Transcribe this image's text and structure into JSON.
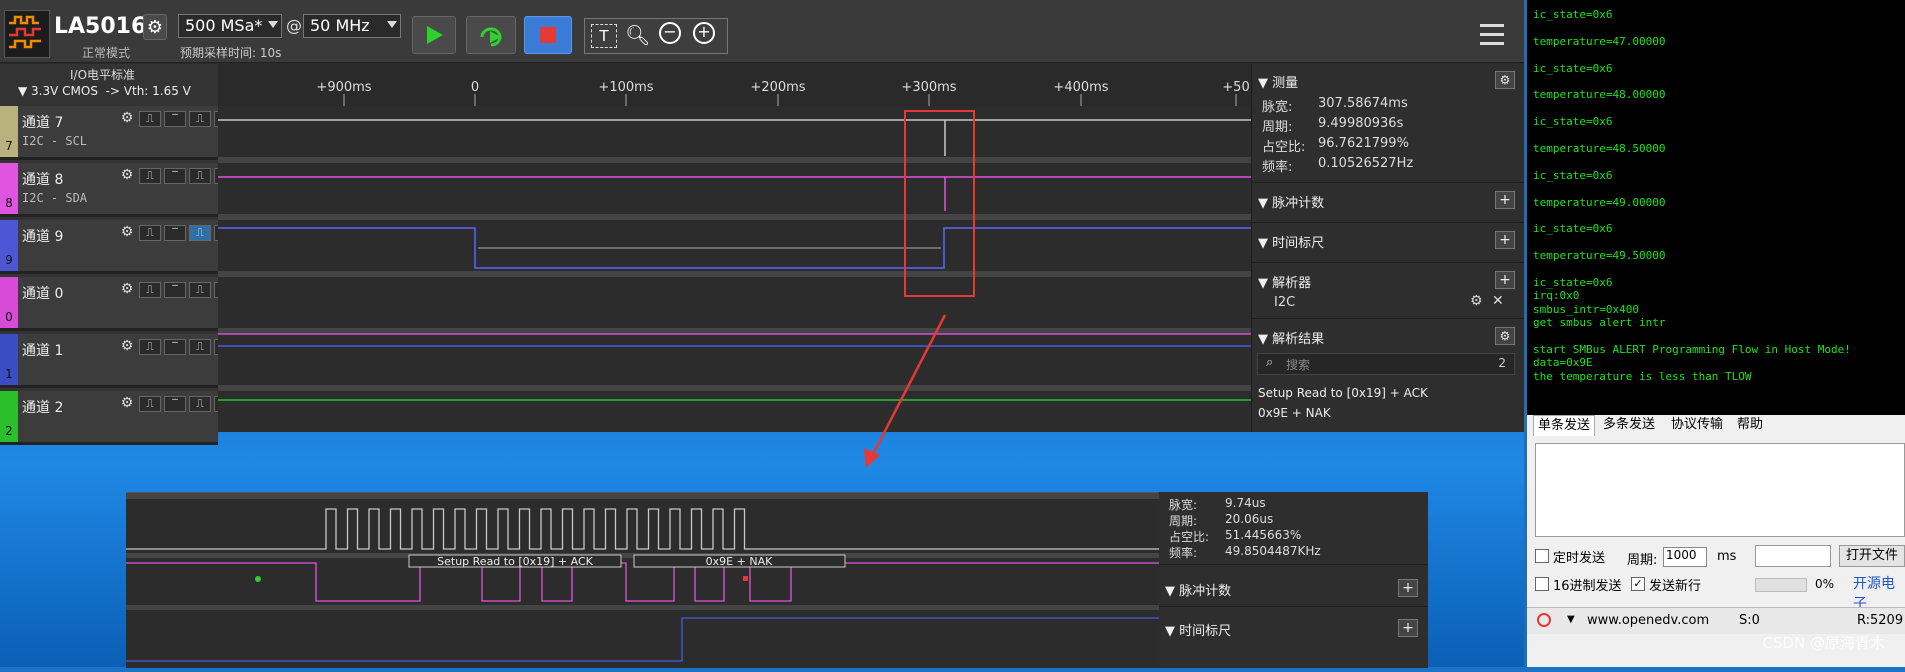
{
  "app": {
    "title": "LA5016",
    "mode": "正常模式"
  },
  "toolbar": {
    "sample_rate": "500 MSa*",
    "at": "@",
    "frequency": "50 MHz",
    "expected_time": "预期采样时间: 10s"
  },
  "io": {
    "header": "I/O电平标准",
    "level": "▼ 3.3V CMOS  -> Vth: 1.65 V"
  },
  "channels": [
    {
      "num": "7",
      "name": "通道 7",
      "sub": "I2C - SCL",
      "color": "#b9b27e"
    },
    {
      "num": "8",
      "name": "通道 8",
      "sub": "I2C - SDA",
      "color": "#e055e0"
    },
    {
      "num": "9",
      "name": "通道 9",
      "sub": "",
      "color": "#4f56d6"
    },
    {
      "num": "0",
      "name": "通道 0",
      "sub": "",
      "color": "#d84bd8"
    },
    {
      "num": "1",
      "name": "通道 1",
      "sub": "",
      "color": "#3a4dc2"
    },
    {
      "num": "2",
      "name": "通道 2",
      "sub": "",
      "color": "#2cbf2c"
    }
  ],
  "timeline": {
    "ticks": [
      "+900ms",
      "0",
      "+100ms",
      "+200ms",
      "+300ms",
      "+400ms",
      "+50"
    ]
  },
  "measure": {
    "title": "测量",
    "rows": [
      {
        "k": "脉宽:",
        "v": "307.58674ms"
      },
      {
        "k": "周期:",
        "v": "9.49980936s"
      },
      {
        "k": "占空比:",
        "v": "96.7621799%"
      },
      {
        "k": "频率:",
        "v": "0.10526527Hz"
      }
    ]
  },
  "panels": {
    "pulse_count": "脉冲计数",
    "time_ruler": "时间标尺",
    "decoder": "解析器",
    "decoder_item": "I2C",
    "results": "解析结果",
    "search_placeholder": "搜索",
    "search_count": "2",
    "result_lines": [
      "Setup Read to [0x19] + ACK",
      "0x9E + NAK"
    ]
  },
  "terminal": {
    "lines": [
      "ic_state=0x6",
      "",
      "temperature=47.00000",
      "",
      "ic_state=0x6",
      "",
      "temperature=48.00000",
      "",
      "ic_state=0x6",
      "",
      "temperature=48.50000",
      "",
      "ic_state=0x6",
      "",
      "temperature=49.00000",
      "",
      "ic_state=0x6",
      "",
      "temperature=49.50000",
      "",
      "ic_state=0x6",
      "irq:0x0",
      "smbus_intr=0x400",
      "get smbus alert intr",
      "",
      "start SMBus ALERT Programming Flow in Host Mode!",
      "data=0x9E",
      "the temperature is less than TLOW"
    ]
  },
  "serial": {
    "tabs": [
      "单条发送",
      "多条发送",
      "协议传输",
      "帮助"
    ],
    "timed_send": "定时发送",
    "period_label": "周期:",
    "period_value": "1000",
    "period_unit": "ms",
    "open_file": "打开文件",
    "hex_send": "16进制发送",
    "newline": "发送新行",
    "percent": "0%",
    "brand": "开源电子",
    "url": "www.openedv.com",
    "s_count": "S:0",
    "r_count": "R:5209"
  },
  "zoom": {
    "measure": [
      {
        "k": "脉宽:",
        "v": "9.74us"
      },
      {
        "k": "周期:",
        "v": "20.06us"
      },
      {
        "k": "占空比:",
        "v": "51.445663%"
      },
      {
        "k": "频率:",
        "v": "49.8504487KHz"
      }
    ],
    "decode1": "Setup Read to [0x19] + ACK",
    "decode2": "0x9E + NAK",
    "pulse_count": "脉冲计数",
    "time_ruler": "时间标尺"
  },
  "watermark": "CSDN @原海青木"
}
